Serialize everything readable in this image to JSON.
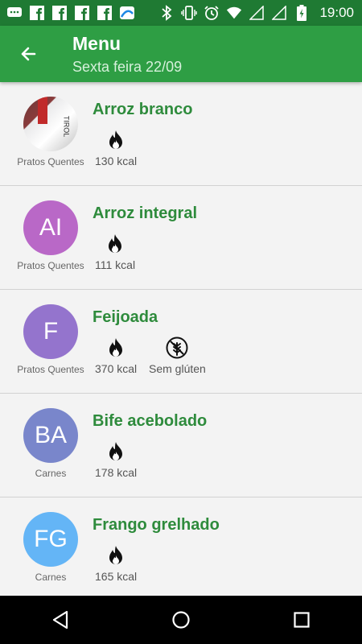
{
  "statusbar": {
    "time": "19:00",
    "left_icons": [
      "chat-icon",
      "facebook-icon",
      "facebook-icon",
      "facebook-icon",
      "facebook-icon",
      "app-icon"
    ],
    "right_icons": [
      "bluetooth-icon",
      "vibrate-icon",
      "alarm-icon",
      "wifi-icon",
      "signal-icon",
      "signal-icon",
      "battery-icon"
    ]
  },
  "header": {
    "title": "Menu",
    "subtitle": "Sexta feira 22/09"
  },
  "colors": {
    "statusbar": "#1f7a33",
    "appbar": "#2e9e44",
    "item_name": "#2e8b3c"
  },
  "items": [
    {
      "name": "Arroz branco",
      "category": "Pratos Quentes",
      "avatar_initials": "",
      "avatar_type": "photo",
      "attributes": [
        {
          "icon": "fire-icon",
          "label": "130 kcal"
        }
      ]
    },
    {
      "name": "Arroz integral",
      "category": "Pratos Quentes",
      "avatar_initials": "AI",
      "avatar_color": "#b968c7",
      "attributes": [
        {
          "icon": "fire-icon",
          "label": "111 kcal"
        }
      ]
    },
    {
      "name": "Feijoada",
      "category": "Pratos Quentes",
      "avatar_initials": "F",
      "avatar_color": "#9474cd",
      "attributes": [
        {
          "icon": "fire-icon",
          "label": "370 kcal"
        },
        {
          "icon": "gluten-free-icon",
          "label": "Sem glúten"
        }
      ]
    },
    {
      "name": "Bife acebolado",
      "category": "Carnes",
      "avatar_initials": "BA",
      "avatar_color": "#7986cb",
      "attributes": [
        {
          "icon": "fire-icon",
          "label": "178 kcal"
        }
      ]
    },
    {
      "name": "Frango grelhado",
      "category": "Carnes",
      "avatar_initials": "FG",
      "avatar_color": "#64b5f6",
      "attributes": [
        {
          "icon": "fire-icon",
          "label": "165 kcal"
        }
      ]
    }
  ],
  "navbar": {
    "buttons": [
      "back-triangle-icon",
      "home-circle-icon",
      "recents-square-icon"
    ]
  }
}
